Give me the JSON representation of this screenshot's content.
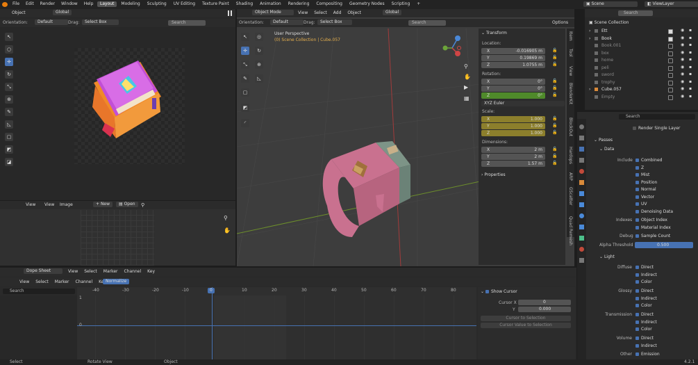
{
  "topbar": {
    "app_menus": [
      "File",
      "Edit",
      "Render",
      "Window",
      "Help"
    ],
    "workspaces": [
      "Layout",
      "Modeling",
      "Sculpting",
      "UV Editing",
      "Texture Paint",
      "Shading",
      "Animation",
      "Rendering",
      "Compositing",
      "Geometry Nodes",
      "Scripting"
    ],
    "active_workspace": "Layout",
    "scene_label": "Scene",
    "viewlayer_label": "ViewLayer"
  },
  "image_editor": {
    "object_menu": "Object",
    "global_label": "Global",
    "orientation_label": "Orientation:",
    "orientation_value": "Default",
    "drag_label": "Drag:",
    "drag_value": "Select Box",
    "search_placeholder": "Search"
  },
  "image_sub": {
    "menus": [
      "View",
      "View",
      "Image"
    ],
    "new_label": "New",
    "open_label": "Open"
  },
  "viewport": {
    "mode": "Object Mode",
    "menus": [
      "View",
      "Select",
      "Add",
      "Object"
    ],
    "global_label": "Global",
    "orientation_label": "Orientation:",
    "orientation_value": "Default",
    "drag_label": "Drag:",
    "drag_value": "Select Box",
    "search_placeholder": "Search",
    "options_label": "Options",
    "overlay_title": "User Perspective",
    "overlay_subtitle": "(0) Scene Collection | Cube.057"
  },
  "npanel": {
    "transform_title": "Transform",
    "location_label": "Location:",
    "location": [
      {
        "axis": "X",
        "value": "-0.016905 m"
      },
      {
        "axis": "Y",
        "value": "0.19869 m"
      },
      {
        "axis": "Z",
        "value": "1.0755 m"
      }
    ],
    "rotation_label": "Rotation:",
    "rotation": [
      {
        "axis": "X",
        "value": "0°"
      },
      {
        "axis": "Y",
        "value": "0°"
      },
      {
        "axis": "Z",
        "value": "0°"
      }
    ],
    "rotation_mode": "XYZ Euler",
    "scale_label": "Scale:",
    "scale": [
      {
        "axis": "X",
        "value": "1.000"
      },
      {
        "axis": "Y",
        "value": "1.000"
      },
      {
        "axis": "Z",
        "value": "1.000"
      }
    ],
    "dimensions_label": "Dimensions:",
    "dimensions": [
      {
        "axis": "X",
        "value": "2 m"
      },
      {
        "axis": "Y",
        "value": "2 m"
      },
      {
        "axis": "Z",
        "value": "1.57 m"
      }
    ],
    "properties_label": "Properties",
    "tabs": [
      "Item",
      "Tool",
      "View",
      "BlenderKit",
      "BlockOut",
      "Hardops",
      "ARP",
      "GScatter",
      "Quad Remesh"
    ]
  },
  "outliner": {
    "root": "Scene Collection",
    "items": [
      "Ett",
      "Book",
      "Book.001",
      "box",
      "home",
      "peli",
      "sword",
      "trophy",
      "Cube.057",
      "Empty"
    ],
    "search_placeholder": "Search"
  },
  "properties": {
    "render_single_layer": "Render Single Layer",
    "passes_title": "Passes",
    "data_title": "Data",
    "include_label": "Include",
    "include_items": [
      "Combined",
      "Z",
      "Mist",
      "Position",
      "Normal",
      "Vector",
      "UV",
      "Denoising Data"
    ],
    "indexes_label": "Indexes",
    "indexes_items": [
      "Object Index",
      "Material Index"
    ],
    "debug_label": "Debug",
    "debug_item": "Sample Count",
    "alpha_label": "Alpha Threshold",
    "alpha_value": "0.500",
    "light_title": "Light",
    "diffuse_label": "Diffuse",
    "glossy_label": "Glossy",
    "transmission_label": "Transmission",
    "volume_label": "Volume",
    "other_label": "Other",
    "light_items": [
      "Direct",
      "Indirect",
      "Color"
    ],
    "volume_items": [
      "Direct",
      "Indirect"
    ],
    "other_item": "Emission"
  },
  "dopesheet": {
    "mode": "Dope Sheet",
    "menus": [
      "View",
      "Select",
      "Marker",
      "Channel",
      "Key"
    ],
    "sub_menus": [
      "View",
      "Select",
      "Marker",
      "Channel",
      "Key"
    ],
    "normalize_label": "Normalize",
    "search_placeholder": "Search",
    "ruler": [
      "-40",
      "-30",
      "-20",
      "-10",
      "0",
      "10",
      "20",
      "30",
      "40",
      "50",
      "60",
      "70",
      "80"
    ],
    "current_frame": "0",
    "y_top": "1",
    "y_zero": "0",
    "show_cursor": "Show Cursor",
    "cursor_x_label": "Cursor X",
    "cursor_x_value": "0",
    "cursor_y_label": "Y",
    "cursor_y_value": "0.000",
    "cursor_to_selection": "Cursor to Selection",
    "cursor_value_to_selection": "Cursor Value to Selection"
  },
  "status": {
    "select": "Select",
    "rotate_view": "Rotate View",
    "object": "Object",
    "version": "4.2.1"
  }
}
